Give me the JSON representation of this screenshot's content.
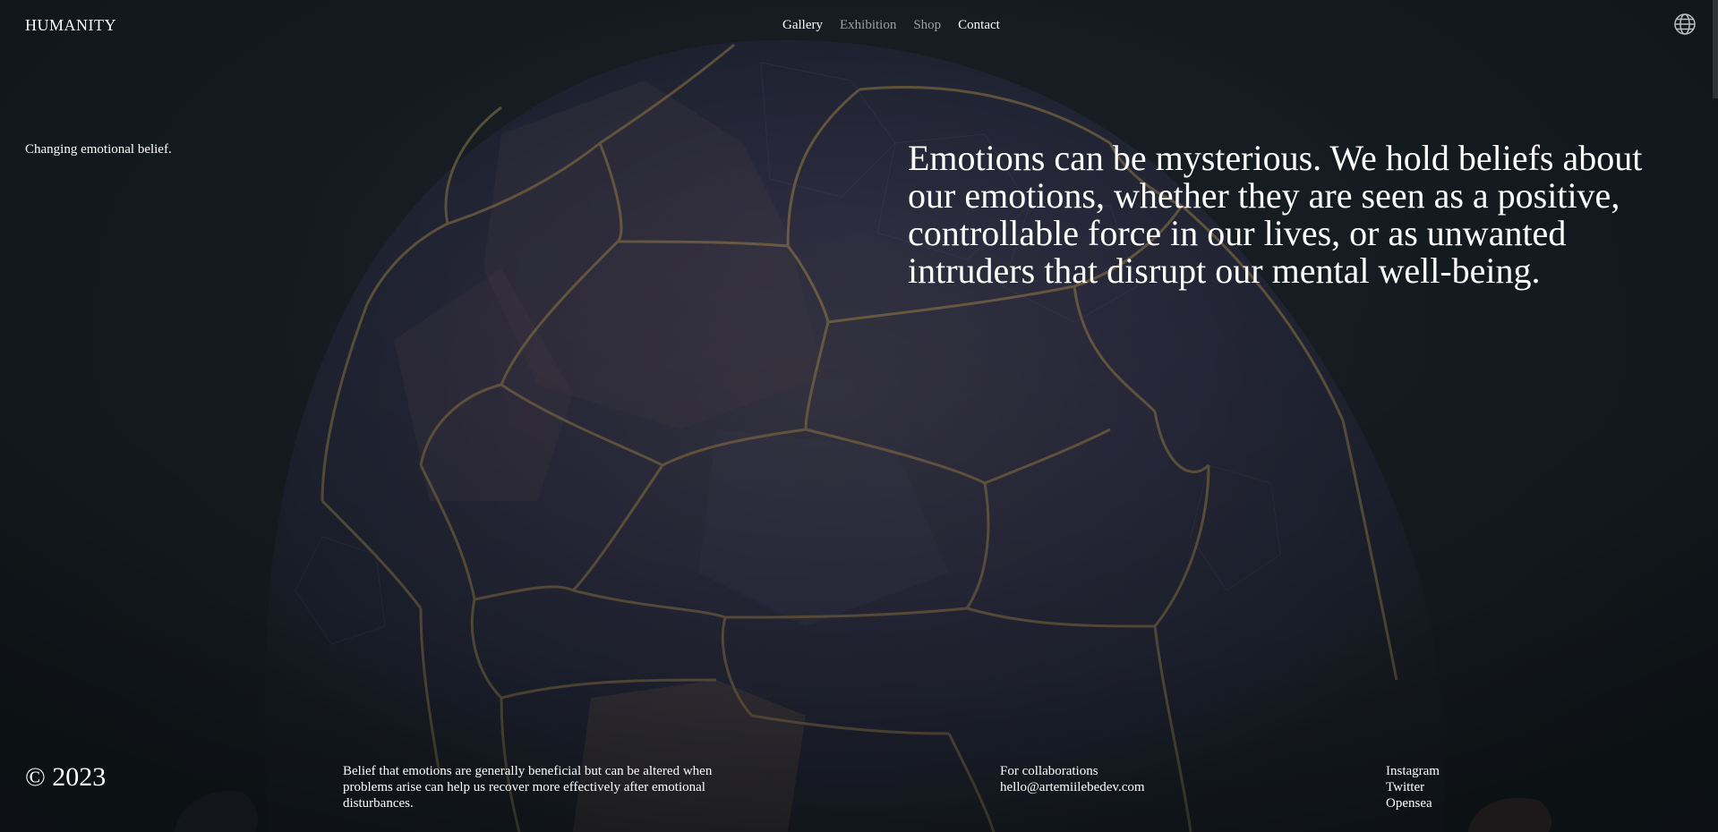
{
  "header": {
    "logo": "HUMANITY",
    "nav": [
      {
        "label": "Gallery",
        "active": true
      },
      {
        "label": "Exhibition",
        "active": false
      },
      {
        "label": "Shop",
        "active": false
      },
      {
        "label": "Contact",
        "active": true
      }
    ],
    "language_icon": "globe-icon"
  },
  "hero": {
    "tagline": "Changing emotional belief.",
    "statement": "Emotions can be mysterious. We hold beliefs about our emotions, whether they are seen as a positive, controllable force in our lives, or as unwanted intruders that disrupt our mental well-being."
  },
  "footer": {
    "copyright": "© 2023",
    "description": "Belief that emotions are generally beneficial but can be altered when problems arise can help us recover more effectively after emotional disturbances.",
    "collab_label": "For collaborations",
    "collab_email": "hello@artemiilebedev.com",
    "socials": [
      "Instagram",
      "Twitter",
      "Opensea"
    ]
  },
  "colors": {
    "background": "#1a2227",
    "text": "#ffffff",
    "nav_dim": "#9aa0a4",
    "artwork_gold": "#b8955a",
    "artwork_blue": "#3f4470"
  }
}
